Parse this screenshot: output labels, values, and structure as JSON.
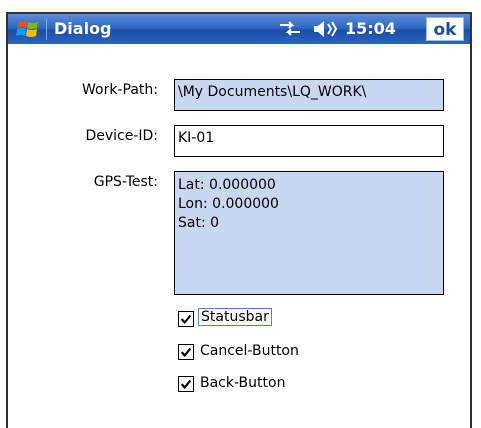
{
  "titlebar": {
    "title": "Dialog",
    "clock": "15:04",
    "ok_label": "ok",
    "icons": [
      "windows-start-icon",
      "network-icon",
      "volume-icon"
    ]
  },
  "form": {
    "work_path": {
      "label": "Work-Path:",
      "value": "\\My Documents\\LQ_WORK\\"
    },
    "device_id": {
      "label": "Device-ID:",
      "value": "KI-01"
    },
    "gps_test": {
      "label": "GPS-Test:",
      "value": "Lat: 0.000000\nLon: 0.000000\nSat: 0"
    }
  },
  "checkboxes": [
    {
      "label": "Statusbar",
      "checked": true
    },
    {
      "label": "Cancel-Button",
      "checked": true
    },
    {
      "label": "Back-Button",
      "checked": true
    }
  ],
  "colors": {
    "titlebar": "#2f68c4",
    "field_blue": "#c9d8f2",
    "ok_text": "#1b4fa6"
  }
}
